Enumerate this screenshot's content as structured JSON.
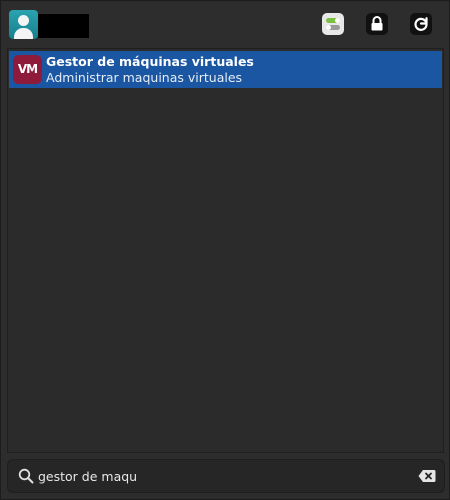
{
  "header": {
    "username": "",
    "buttons": {
      "settings": "settings-toggle-icon",
      "lock": "lock-icon",
      "refresh": "power-refresh-icon"
    }
  },
  "results": [
    {
      "icon_text": "VM",
      "title": "Gestor de máquinas virtuales",
      "description": "Administrar maquinas virtuales",
      "selected": true
    }
  ],
  "search": {
    "value": "gestor de maqu",
    "placeholder": ""
  },
  "colors": {
    "selection": "#1b56a3",
    "app_icon_bg": "#8e1b3a",
    "accent_green": "#7bc043",
    "avatar_teal": "#17808d"
  }
}
